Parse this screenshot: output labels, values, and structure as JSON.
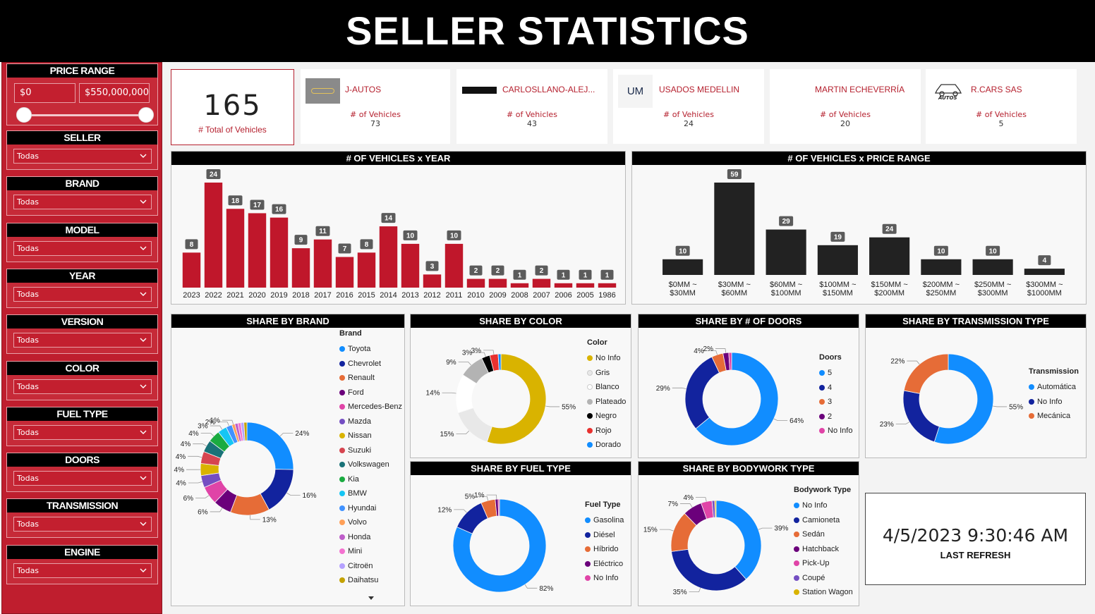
{
  "title": "SELLER STATISTICS",
  "filters": {
    "price_range": {
      "title": "PRICE RANGE",
      "min": "$0",
      "max": "$550,000,000"
    },
    "items": [
      {
        "title": "SELLER",
        "value": "Todas"
      },
      {
        "title": "BRAND",
        "value": "Todas"
      },
      {
        "title": "MODEL",
        "value": "Todas"
      },
      {
        "title": "YEAR",
        "value": "Todas"
      },
      {
        "title": "VERSION",
        "value": "Todas"
      },
      {
        "title": "COLOR",
        "value": "Todas"
      },
      {
        "title": "FUEL TYPE",
        "value": "Todas"
      },
      {
        "title": "DOORS",
        "value": "Todas"
      },
      {
        "title": "TRANSMISSION",
        "value": "Todas"
      },
      {
        "title": "ENGINE",
        "value": "Todas"
      }
    ]
  },
  "kpi": {
    "value": "165",
    "label": "# Total of Vehicles"
  },
  "sellers": [
    {
      "name": "J-AUTOS",
      "label": "# of Vehicles",
      "value": "73",
      "logo": "j-autos-logo"
    },
    {
      "name": "CARLOSLLANO-ALEJ...",
      "label": "# of Vehicles",
      "value": "43",
      "logo": "carlosllano-logo"
    },
    {
      "name": "USADOS MEDELLIN",
      "label": "# of Vehicles",
      "value": "24",
      "logo": "um-logo",
      "logo_text": "UM"
    },
    {
      "name": "MARTIN ECHEVERRÍA",
      "label": "# of Vehicles",
      "value": "20",
      "logo": ""
    },
    {
      "name": "R.CARS SAS",
      "label": "# of Vehicles",
      "value": "5",
      "logo": "r-cars-logo",
      "logo_text": "AUTOS"
    }
  ],
  "chart_data": [
    {
      "type": "bar",
      "title": "# OF VEHICLES x YEAR",
      "categories": [
        "2023",
        "2022",
        "2021",
        "2020",
        "2019",
        "2018",
        "2017",
        "2016",
        "2015",
        "2014",
        "2013",
        "2012",
        "2011",
        "2010",
        "2009",
        "2008",
        "2007",
        "2006",
        "2005",
        "1986"
      ],
      "values": [
        8,
        24,
        18,
        17,
        16,
        9,
        11,
        7,
        8,
        14,
        10,
        3,
        10,
        2,
        2,
        1,
        2,
        1,
        1,
        1
      ],
      "color": "#c0172b"
    },
    {
      "type": "bar",
      "title": "# OF VEHICLES x PRICE RANGE",
      "categories": [
        [
          "$0MM ~",
          "$30MM"
        ],
        [
          "$30MM ~",
          "$60MM"
        ],
        [
          "$60MM ~",
          "$100MM"
        ],
        [
          "$100MM ~",
          "$150MM"
        ],
        [
          "$150MM ~",
          "$200MM"
        ],
        [
          "$200MM ~",
          "$250MM"
        ],
        [
          "$250MM ~",
          "$300MM"
        ],
        [
          "$300MM ~",
          "$1000MM"
        ]
      ],
      "values": [
        10,
        59,
        29,
        19,
        24,
        10,
        10,
        4
      ],
      "color": "#222222"
    },
    {
      "type": "pie",
      "title": "SHARE BY BRAND",
      "legend_title": "Brand",
      "labels": [
        "Toyota",
        "Chevrolet",
        "Renault",
        "Ford",
        "Mercedes-Benz",
        "Mazda",
        "Nissan",
        "Suzuki",
        "Volkswagen",
        "Kia",
        "BMW",
        "Hyundai",
        "Volvo",
        "Honda",
        "Mini",
        "Citroën",
        "Daihatsu"
      ],
      "values": [
        24,
        16,
        13,
        6,
        6,
        4,
        4,
        4,
        4,
        4,
        3,
        2,
        1,
        1,
        1,
        1,
        1
      ],
      "colors": [
        "#118dff",
        "#12239e",
        "#e66c37",
        "#6b007b",
        "#e044a7",
        "#744ec2",
        "#d9b300",
        "#d64550",
        "#197278",
        "#1aab40",
        "#15c6f4",
        "#4092ff",
        "#ffa058",
        "#be5dc9",
        "#f472d0",
        "#b5a1ff",
        "#c4a200"
      ],
      "pct_labels": [
        "24%",
        "16%",
        "13%",
        "6%",
        "6%",
        "4%",
        "4%",
        "4%",
        "4%",
        "4%",
        "3%",
        "2%",
        "1%"
      ]
    },
    {
      "type": "pie",
      "title": "SHARE BY COLOR",
      "legend_title": "Color",
      "labels": [
        "No Info",
        "Gris",
        "Blanco",
        "Plateado",
        "Negro",
        "Rojo",
        "Dorado"
      ],
      "values": [
        55,
        15,
        14,
        9,
        3,
        3,
        1
      ],
      "colors": [
        "#d9b300",
        "#e8e8e8",
        "#ffffff",
        "#b3b3b3",
        "#000000",
        "#e8312f",
        "#118dff"
      ],
      "pct_labels": [
        "55%",
        "15%",
        "14%",
        "9%",
        "3%",
        "3%"
      ]
    },
    {
      "type": "pie",
      "title": "SHARE BY # OF DOORS",
      "legend_title": "Doors",
      "labels": [
        "5",
        "4",
        "3",
        "2",
        "No Info"
      ],
      "values": [
        64,
        29,
        4,
        2,
        1
      ],
      "colors": [
        "#118dff",
        "#12239e",
        "#e66c37",
        "#6b007b",
        "#e044a7"
      ],
      "pct_labels": [
        "64%",
        "29%",
        "4%",
        "2%"
      ]
    },
    {
      "type": "pie",
      "title": "SHARE BY TRANSMISSION TYPE",
      "legend_title": "Transmission",
      "labels": [
        "Automática",
        "No Info",
        "Mecánica"
      ],
      "values": [
        55,
        23,
        22
      ],
      "colors": [
        "#118dff",
        "#12239e",
        "#e66c37"
      ],
      "pct_labels": [
        "55%",
        "23%",
        "22%"
      ]
    },
    {
      "type": "pie",
      "title": "SHARE BY FUEL TYPE",
      "legend_title": "Fuel Type",
      "labels": [
        "Gasolina",
        "Diésel",
        "Híbrido",
        "Eléctrico",
        "No Info"
      ],
      "values": [
        82,
        12,
        5,
        1,
        0.5
      ],
      "colors": [
        "#118dff",
        "#12239e",
        "#e66c37",
        "#6b007b",
        "#e044a7"
      ],
      "pct_labels": [
        "82%",
        "12%",
        "5%",
        "1%"
      ]
    },
    {
      "type": "pie",
      "title": "SHARE BY BODYWORK TYPE",
      "legend_title": "Bodywork Type",
      "labels": [
        "No Info",
        "Camioneta",
        "Sedán",
        "Hatchback",
        "Pick-Up",
        "Coupé",
        "Station Wagon"
      ],
      "values": [
        39,
        35,
        15,
        7,
        4,
        1,
        0.5
      ],
      "colors": [
        "#118dff",
        "#12239e",
        "#e66c37",
        "#6b007b",
        "#e044a7",
        "#744ec2",
        "#d9b300"
      ],
      "pct_labels": [
        "39%",
        "35%",
        "15%",
        "7%",
        "4%"
      ]
    }
  ],
  "refresh": {
    "value": "4/5/2023 9:30:46 AM",
    "label": "LAST REFRESH"
  }
}
